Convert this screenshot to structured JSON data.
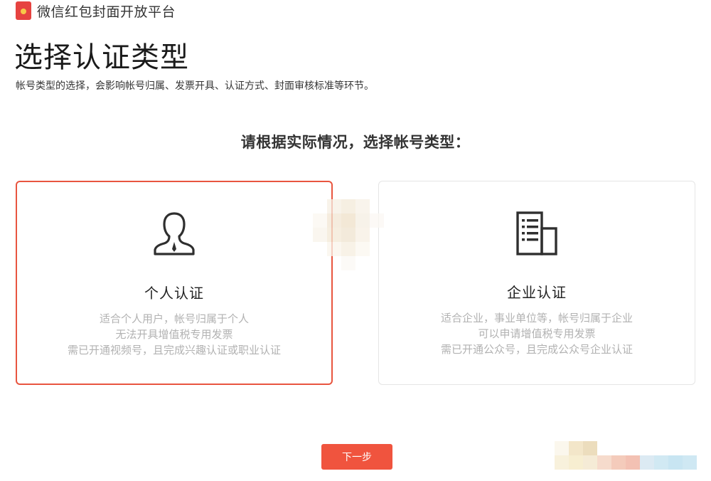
{
  "header": {
    "brand_name": "微信红包封面开放平台",
    "title": "选择认证类型",
    "description": "帐号类型的选择，会影响帐号归属、发票开具、认证方式、封面审核标准等环节。"
  },
  "main": {
    "prompt": "请根据实际情况，选择帐号类型：",
    "cards": [
      {
        "title": "个人认证",
        "icon": "person-icon",
        "selected": true,
        "lines": [
          "适合个人用户，帐号归属于个人",
          "无法开具增值税专用发票",
          "需已开通视频号，且完成兴趣认证或职业认证"
        ]
      },
      {
        "title": "企业认证",
        "icon": "building-icon",
        "selected": false,
        "lines": [
          "适合企业，事业单位等，帐号归属于企业",
          "可以申请增值税专用发票",
          "需已开通公众号，且完成公众号企业认证"
        ]
      }
    ],
    "next_label": "下一步"
  },
  "colors": {
    "accent": "#f0543e",
    "selected_border": "#e8553f",
    "muted_text": "#b2b2b2"
  }
}
